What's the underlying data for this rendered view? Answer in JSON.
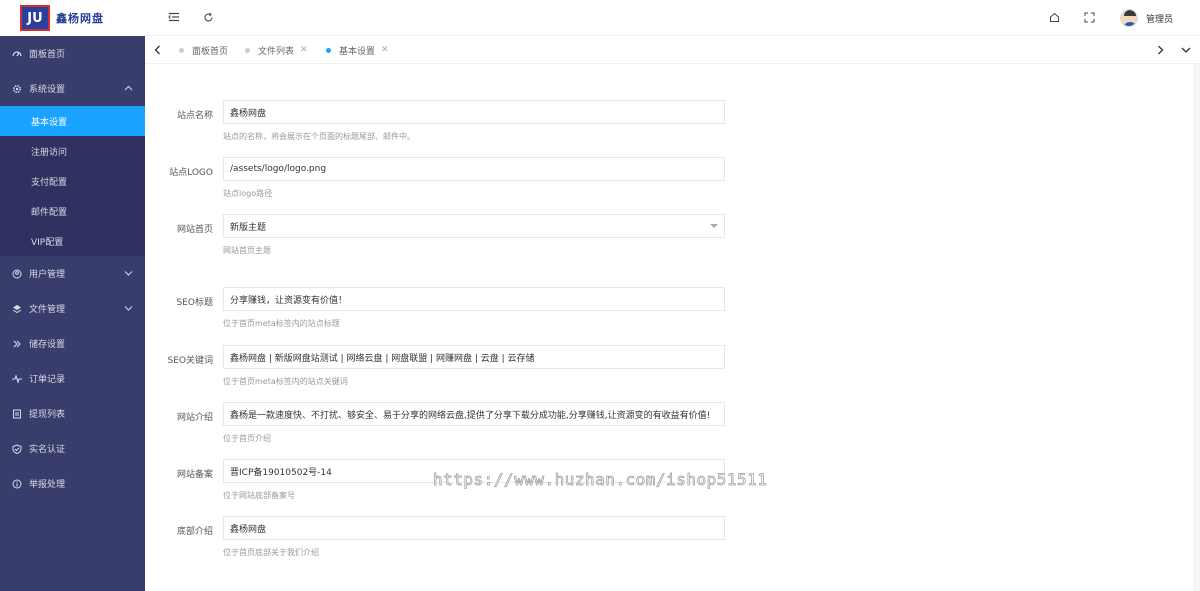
{
  "brand": {
    "logo_mark": "JU",
    "logo_text": "鑫杨网盘"
  },
  "sidebar": {
    "items": [
      {
        "label": "面板首页",
        "icon": "dashboard-icon"
      },
      {
        "label": "系统设置",
        "icon": "gear-icon",
        "expanded": true,
        "children": [
          {
            "label": "基本设置",
            "active": true
          },
          {
            "label": "注册访问"
          },
          {
            "label": "支付配置"
          },
          {
            "label": "邮件配置"
          },
          {
            "label": "VIP配置"
          }
        ]
      },
      {
        "label": "用户管理",
        "icon": "user-circle-icon"
      },
      {
        "label": "文件管理",
        "icon": "layers-icon"
      },
      {
        "label": "储存设置",
        "icon": "storage-icon"
      },
      {
        "label": "订单记录",
        "icon": "pulse-icon"
      },
      {
        "label": "提现列表",
        "icon": "list-icon"
      },
      {
        "label": "实名认证",
        "icon": "shield-check-icon"
      },
      {
        "label": "举报处理",
        "icon": "info-icon"
      }
    ]
  },
  "topbar": {
    "username": "管理员"
  },
  "tabs": [
    {
      "label": "面板首页"
    },
    {
      "label": "文件列表"
    },
    {
      "label": "基本设置",
      "active": true
    }
  ],
  "form": {
    "fields": [
      {
        "label": "站点名称",
        "value": "鑫杨网盘",
        "help": "站点的名称，将会展示在个页面的标题尾部、邮件中。"
      },
      {
        "label": "站点LOGO",
        "value": "/assets/logo/logo.png",
        "help": "站点logo路径"
      },
      {
        "label": "网站首页",
        "value": "新版主题",
        "help": "网站首页主题",
        "type": "select"
      },
      {
        "label": "SEO标题",
        "value": "分享赚钱，让资源变有价值！",
        "help": "位于首页meta标签内的站点标题"
      },
      {
        "label": "SEO关键词",
        "value": "鑫杨网盘 | 新版网盘站测试 | 网络云盘 | 网盘联盟 | 网赚网盘 | 云盘 | 云存储",
        "help": "位于首页meta标签内的站点关键词"
      },
      {
        "label": "网站介绍",
        "value": "鑫杨是一款速度快、不打扰、够安全、易于分享的网络云盘,提供了分享下载分成功能,分享赚钱,让资源变的有收益有价值!",
        "help": "位于首页介绍"
      },
      {
        "label": "网站备案",
        "value": "晋ICP备19010502号-14",
        "help": "位于网站底部备案号"
      },
      {
        "label": "底部介绍",
        "value": "鑫杨网盘",
        "help": "位于首页底部关于我们介绍"
      }
    ]
  },
  "watermark": "https://www.huzhan.com/ishop51511",
  "colors": {
    "sidebar_bg": "#393d6b",
    "active": "#1aa3ff"
  }
}
